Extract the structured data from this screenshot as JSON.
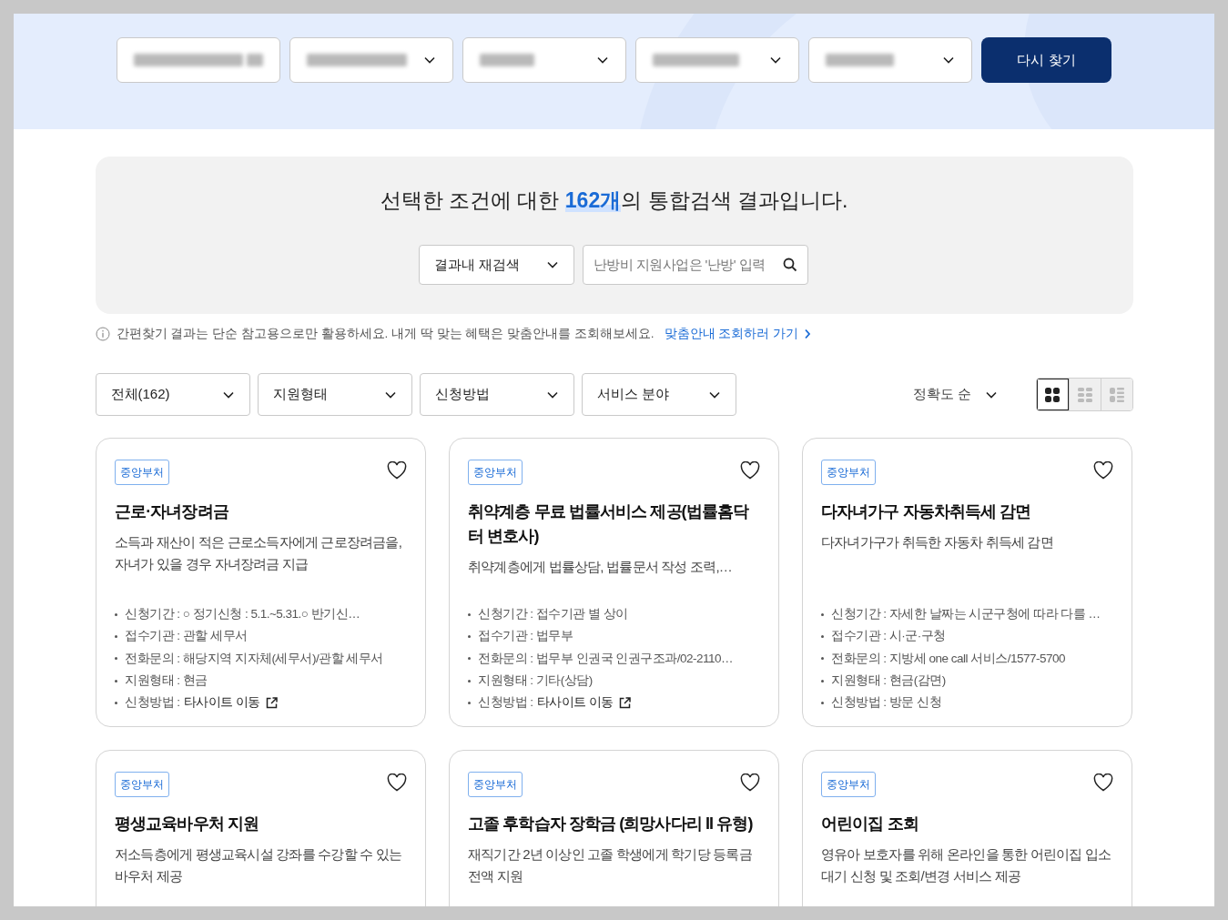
{
  "top_filters": [
    {
      "chevron": false
    },
    {
      "chevron": true
    },
    {
      "chevron": true
    },
    {
      "chevron": true
    },
    {
      "chevron": true
    }
  ],
  "search_again_button": "다시 찾기",
  "result": {
    "sentence": "선택한 조건에 대한 **162개**의 통합검색 결과입니다.",
    "scope_select": "결과내 재검색",
    "search": {
      "placeholder": "난방비 지원사업은 '난방' 입력"
    }
  },
  "notice": {
    "text": "간편찾기 결과는 단순 참고용으로만 활용하세요. 내게 딱 맞는 혜택은 맞춤안내를 조회해보세요.",
    "link": "맞춤안내 조회하러 가기"
  },
  "filters": [
    "전체(162)",
    "지원형태",
    "신청방법",
    "서비스 분야"
  ],
  "sort": "정확도 순",
  "view_modes": [
    {
      "kind": "grid",
      "selected": true
    },
    {
      "kind": "tiles",
      "selected": false
    },
    {
      "kind": "list",
      "selected": false
    }
  ],
  "cards": [
    {
      "tag": "중앙부처",
      "favorite": false,
      "title": "근로·자녀장려금",
      "description": "소득과 재산이 적은 근로소득자에게 근로장려금을, 자녀가 있을 경우 자녀장려금 지급",
      "details": [
        {
          "kind": "text",
          "text": "신청기간 : ○ 정기신청 : 5.1.~5.31.○ 반기신…"
        },
        {
          "kind": "text",
          "text": "접수기관 : 관할 세무서"
        },
        {
          "kind": "text",
          "text": "전화문의 : 해당지역 지자체(세무서)/관할 세무서"
        },
        {
          "kind": "text",
          "text": "지원형태 : 현금"
        },
        {
          "kind": "link",
          "text": "신청방법 :",
          "link": "타사이트 이동"
        }
      ]
    },
    {
      "tag": "중앙부처",
      "favorite": false,
      "title": "취약계층 무료 법률서비스 제공(법률홈닥터 변호사)",
      "description": "취약계층에게 법률상담, 법률문서 작성 조력,…",
      "details": [
        {
          "kind": "text",
          "text": "신청기간 : 접수기관 별 상이"
        },
        {
          "kind": "text",
          "text": "접수기관 : 법무부"
        },
        {
          "kind": "text",
          "text": "전화문의 : 법무부 인권국 인권구조과/02-2110…"
        },
        {
          "kind": "text",
          "text": "지원형태 : 기타(상담)"
        },
        {
          "kind": "link",
          "text": "신청방법 :",
          "link": "타사이트 이동"
        }
      ]
    },
    {
      "tag": "중앙부처",
      "favorite": false,
      "title": "다자녀가구 자동차취득세 감면",
      "description": "다자녀가구가 취득한 자동차 취득세 감면",
      "details": [
        {
          "kind": "text",
          "text": "신청기간 : 자세한 날짜는 시군구청에 따라 다를 …"
        },
        {
          "kind": "text",
          "text": "접수기관 : 시·군·구청"
        },
        {
          "kind": "text",
          "text": "전화문의 : 지방세 one call 서비스/1577-5700"
        },
        {
          "kind": "text",
          "text": "지원형태 : 현금(감면)"
        },
        {
          "kind": "text",
          "text": "신청방법 : 방문 신청"
        }
      ]
    },
    {
      "tag": "중앙부처",
      "favorite": false,
      "title": "평생교육바우처 지원",
      "description": "저소득층에게 평생교육시설 강좌를 수강할 수 있는 바우처 제공"
    },
    {
      "tag": "중앙부처",
      "favorite": false,
      "title": "고졸 후학습자 장학금 (희망사다리 II 유형)",
      "description": "재직기간 2년 이상인 고졸 학생에게 학기당 등록금 전액 지원"
    },
    {
      "tag": "중앙부처",
      "favorite": false,
      "title": "어린이집 조회",
      "description": "영유아 보호자를 위해 온라인을 통한 어린이집 입소대기 신청 및 조회/변경 서비스 제공"
    }
  ]
}
